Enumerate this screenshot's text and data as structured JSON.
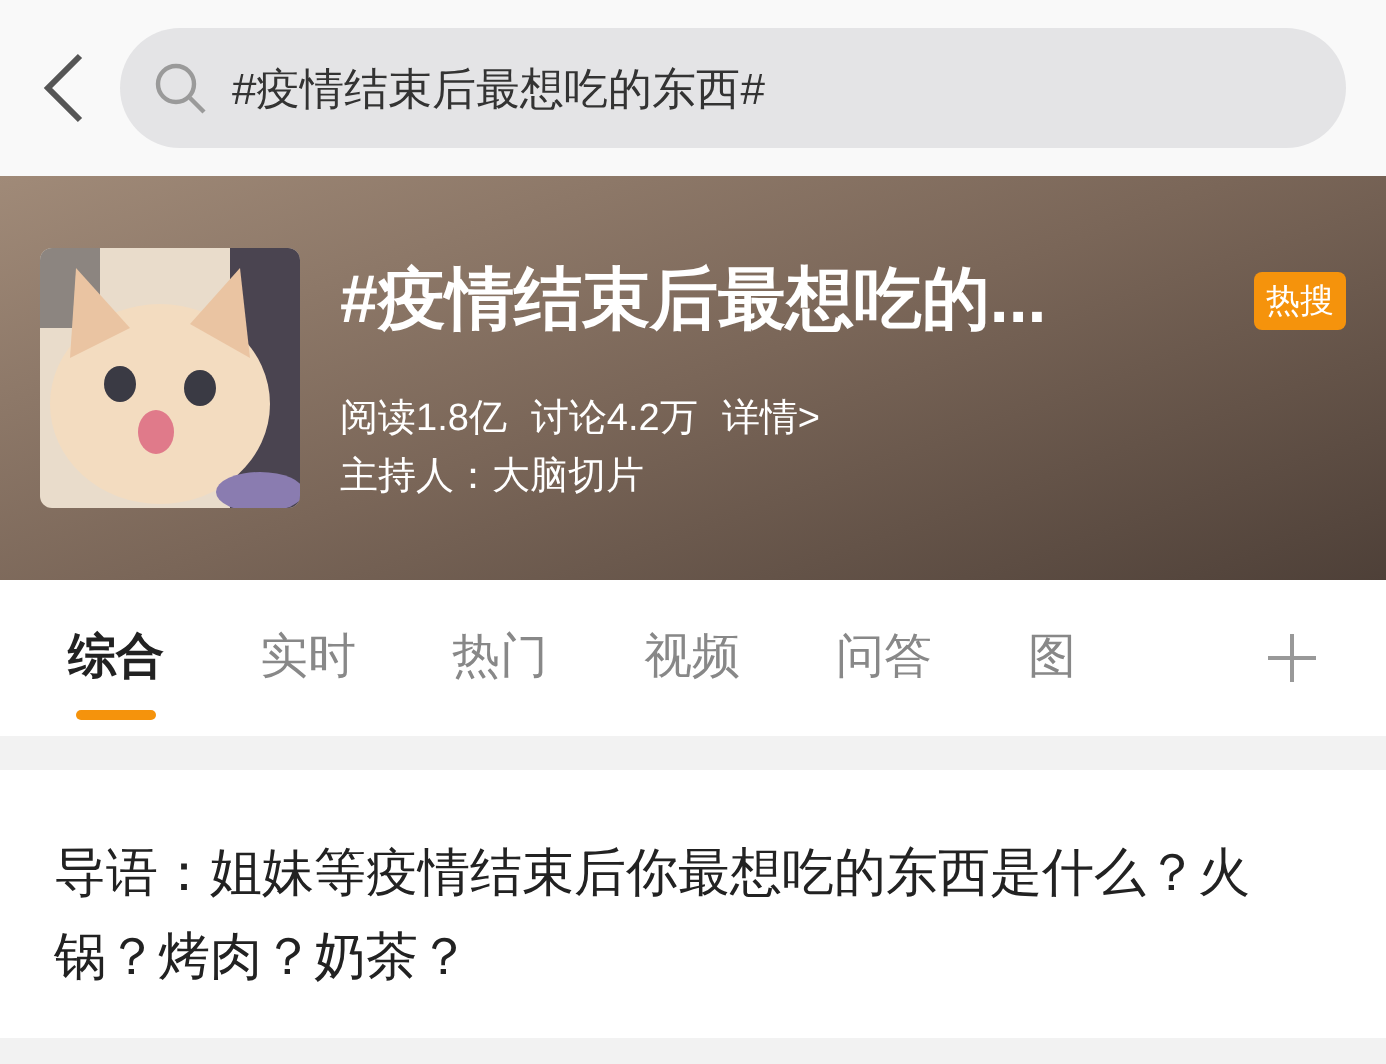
{
  "search": {
    "value": "#疫情结束后最想吃的东西#"
  },
  "topic": {
    "title": "#疫情结束后最想吃的...",
    "badge": "热搜",
    "reads": "阅读1.8亿",
    "discussions": "讨论4.2万",
    "details_link": "详情>",
    "host": "主持人：大脑切片"
  },
  "tabs": [
    {
      "label": "综合",
      "selected": true
    },
    {
      "label": "实时",
      "selected": false
    },
    {
      "label": "热门",
      "selected": false
    },
    {
      "label": "视频",
      "selected": false
    },
    {
      "label": "问答",
      "selected": false
    },
    {
      "label": "图",
      "selected": false
    }
  ],
  "intro": "导语：姐妹等疫情结束后你最想吃的东西是什么？火锅？烤肉？奶茶？"
}
